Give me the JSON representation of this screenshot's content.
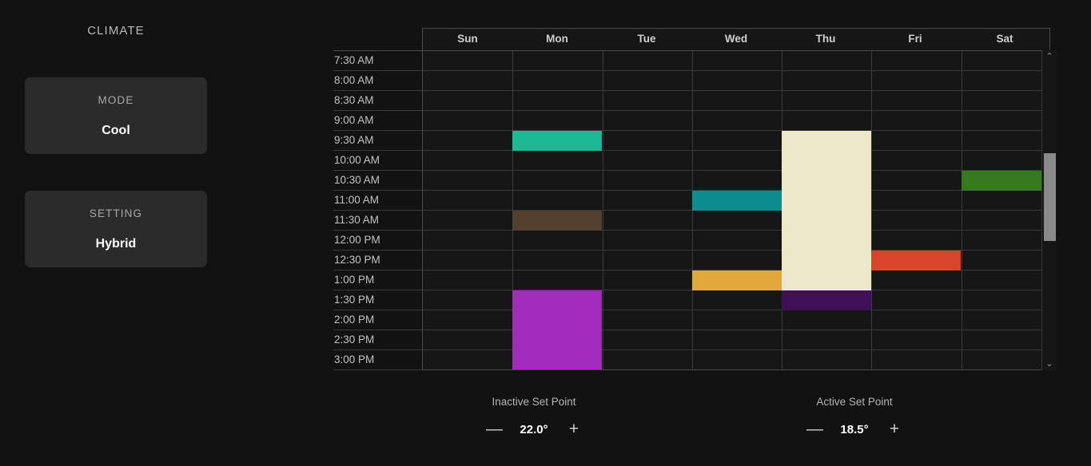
{
  "panel": {
    "title": "CLIMATE",
    "cards": [
      {
        "label": "MODE",
        "value": "Cool",
        "name": "mode"
      },
      {
        "label": "SETTING",
        "value": "Hybrid",
        "name": "setting"
      }
    ]
  },
  "calendar": {
    "days": [
      "Sun",
      "Mon",
      "Tue",
      "Wed",
      "Thu",
      "Fri",
      "Sat"
    ],
    "times": [
      "7:30 AM",
      "8:00 AM",
      "8:30 AM",
      "9:00 AM",
      "9:30 AM",
      "10:00 AM",
      "10:30 AM",
      "11:00 AM",
      "11:30 AM",
      "12:00 PM",
      "12:30 PM",
      "1:00 PM",
      "1:30 PM",
      "2:00 PM",
      "2:30 PM",
      "3:00 PM"
    ],
    "events": [
      {
        "day": "Mon",
        "start": "9:30 AM",
        "end": "10:00 AM",
        "color": "#1cb894",
        "name": "event-mon-0930"
      },
      {
        "day": "Sat",
        "start": "10:30 AM",
        "end": "11:00 AM",
        "color": "#357a1d",
        "name": "event-sat-1030"
      },
      {
        "day": "Wed",
        "start": "11:00 AM",
        "end": "11:30 AM",
        "color": "#0c8c8c",
        "name": "event-wed-1100"
      },
      {
        "day": "Mon",
        "start": "11:30 AM",
        "end": "12:00 PM",
        "color": "#52402f",
        "name": "event-mon-1130"
      },
      {
        "day": "Thu",
        "start": "9:30 AM",
        "end": "1:30 PM",
        "color": "#ede8c8",
        "name": "event-thu-0930"
      },
      {
        "day": "Fri",
        "start": "12:30 PM",
        "end": "1:00 PM",
        "color": "#d9452a",
        "name": "event-fri-1230"
      },
      {
        "day": "Wed",
        "start": "1:00 PM",
        "end": "1:30 PM",
        "color": "#e0a93a",
        "name": "event-wed-1300"
      },
      {
        "day": "Thu",
        "start": "1:30 PM",
        "end": "2:00 PM",
        "color": "#3d1155",
        "name": "event-thu-1330"
      },
      {
        "day": "Mon",
        "start": "1:30 PM",
        "end": "3:30 PM",
        "color": "#a22bbd",
        "name": "event-mon-1330"
      }
    ]
  },
  "scrollbar": {
    "up_glyph": "⌃",
    "down_glyph": "⌄"
  },
  "setpoints": [
    {
      "label": "Inactive Set Point",
      "value": "22.0°",
      "minus": "—",
      "plus": "+",
      "name": "inactive"
    },
    {
      "label": "Active Set Point",
      "value": "18.5°",
      "minus": "—",
      "plus": "+",
      "name": "active"
    }
  ]
}
